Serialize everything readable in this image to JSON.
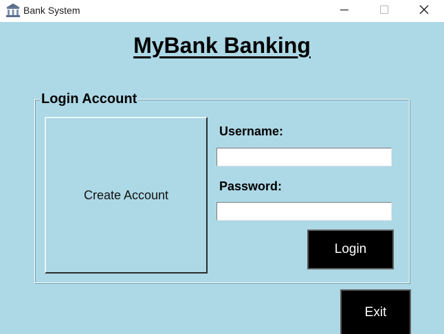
{
  "window": {
    "title": "Bank System",
    "app_icon": "bank-building-icon",
    "controls": [
      "minimize-icon",
      "maximize-icon",
      "close-icon"
    ]
  },
  "header": {
    "title": "MyBank Banking"
  },
  "login_frame": {
    "legend": "Login Account",
    "create_account_label": "Create Account",
    "username_label": "Username:",
    "username_value": "",
    "password_label": "Password:",
    "password_value": "",
    "login_label": "Login"
  },
  "footer": {
    "exit_label": "Exit"
  },
  "colors": {
    "background": "#add8e6",
    "button_dark": "#000000",
    "button_dark_text": "#ffffff"
  }
}
